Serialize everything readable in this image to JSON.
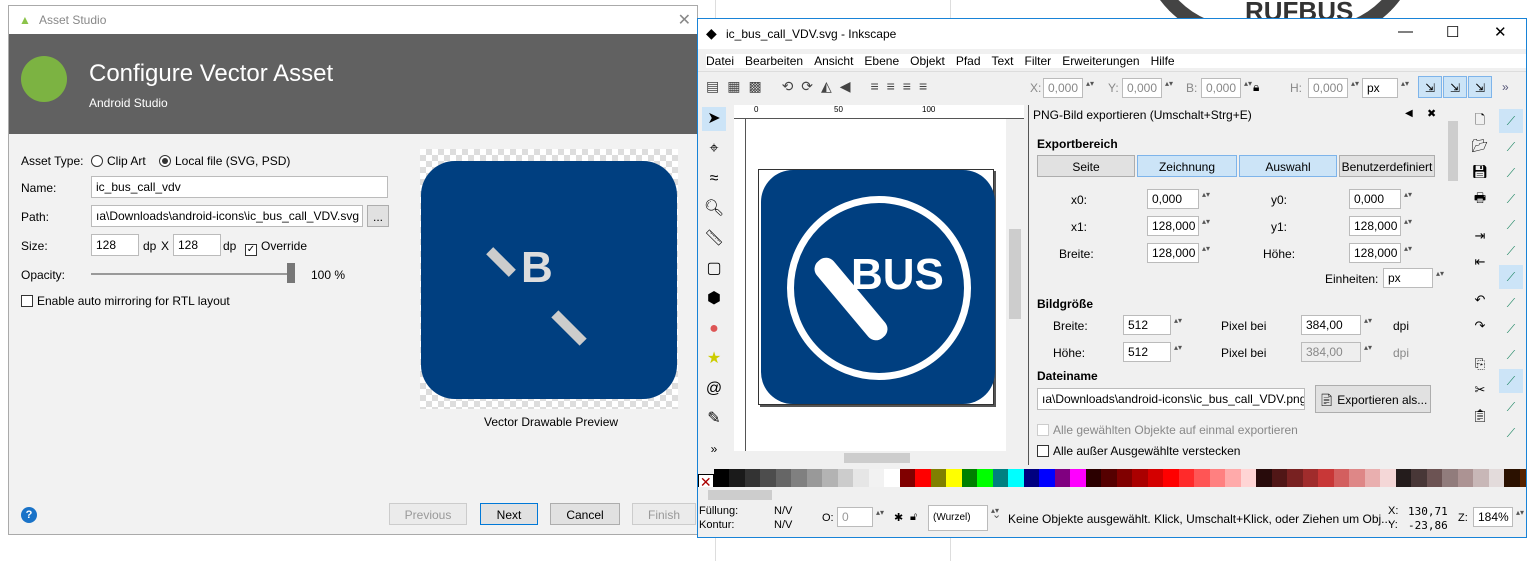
{
  "asset_studio": {
    "window_title": "Asset Studio",
    "header_title": "Configure Vector Asset",
    "header_subtitle": "Android Studio",
    "asset_type_label": "Asset Type:",
    "clip_art_label": "Clip Art",
    "local_file_label": "Local file (SVG, PSD)",
    "selected_asset_type": "Local file (SVG, PSD)",
    "name_label": "Name:",
    "name_value": "ic_bus_call_vdv",
    "path_label": "Path:",
    "path_value": "ıa\\Downloads\\android-icons\\ic_bus_call_VDV.svg",
    "browse_label": "...",
    "size_label": "Size:",
    "width_value": "128",
    "height_value": "128",
    "dp": "dp",
    "x": "X",
    "override_label": "Override",
    "override_checked": true,
    "opacity_label": "Opacity:",
    "opacity_value": "100 %",
    "opacity_percent": 100,
    "rtl_label": "Enable auto mirroring for RTL layout",
    "rtl_checked": false,
    "preview_label": "Vector Drawable Preview",
    "preview_letter": "B",
    "buttons": {
      "previous": "Previous",
      "next": "Next",
      "cancel": "Cancel",
      "finish": "Finish"
    },
    "help": "?"
  },
  "inkscape": {
    "window_title": "ic_bus_call_VDV.svg - Inkscape",
    "menu": [
      "Datei",
      "Bearbeiten",
      "Ansicht",
      "Ebene",
      "Objekt",
      "Pfad",
      "Text",
      "Filter",
      "Erweiterungen",
      "Hilfe"
    ],
    "toolbar": {
      "x_label": "X:",
      "x": "0,000",
      "y_label": "Y:",
      "y": "0,000",
      "b_label": "B:",
      "b": "0,000",
      "h_label": "H:",
      "h": "0,000",
      "unit": "px",
      "more": "»"
    },
    "ruler_ticks": [
      "0",
      "50",
      "100"
    ],
    "canvas_icon_text": "BUS",
    "export": {
      "title": "PNG-Bild exportieren (Umschalt+Strg+E)",
      "area_heading": "Exportbereich",
      "area_buttons": [
        {
          "label": "Seite",
          "active": false
        },
        {
          "label": "Zeichnung",
          "active": true
        },
        {
          "label": "Auswahl",
          "active": true
        },
        {
          "label": "Benutzerdefiniert",
          "active": false
        }
      ],
      "x0_label": "x0:",
      "x0": "0,000",
      "y0_label": "y0:",
      "y0": "0,000",
      "x1_label": "x1:",
      "x1": "128,000",
      "y1_label": "y1:",
      "y1": "128,000",
      "breite_label": "Breite:",
      "breite": "128,000",
      "hoehe_label": "Höhe:",
      "hoehe": "128,000",
      "units_label": "Einheiten:",
      "units": "px",
      "size_heading": "Bildgröße",
      "img_width_label": "Breite:",
      "img_width": "512",
      "dpi_label": "Pixel bei",
      "dpi": "384,00",
      "dpi_unit": "dpi",
      "img_height_label": "Höhe:",
      "img_height": "512",
      "dpi2": "384,00",
      "filename_heading": "Dateiname",
      "filename": "ıa\\Downloads\\android-icons\\ic_bus_call_VDV.png",
      "export_button": "Exportieren als...",
      "batch_label": "Alle gewählten Objekte auf einmal exportieren",
      "hide_label": "Alle außer Ausgewählte verstecken"
    },
    "palette": [
      "#000000",
      "#1a1a1a",
      "#333333",
      "#4d4d4d",
      "#666666",
      "#808080",
      "#999999",
      "#b3b3b3",
      "#cccccc",
      "#e6e6e6",
      "#f2f2f2",
      "#ffffff",
      "#800000",
      "#ff0000",
      "#808000",
      "#ffff00",
      "#008000",
      "#00ff00",
      "#008080",
      "#00ffff",
      "#000080",
      "#0000ff",
      "#800080",
      "#ff00ff",
      "#2b0000",
      "#550000",
      "#800000",
      "#aa0000",
      "#d40000",
      "#ff0000",
      "#ff2a2a",
      "#ff5555",
      "#ff8080",
      "#ffaaaa",
      "#ffd5d5",
      "#280b0b",
      "#501616",
      "#782121",
      "#a02c2c",
      "#c83737",
      "#d35f5f",
      "#de8787",
      "#e9afaf",
      "#f4d7d7",
      "#241c1c",
      "#483737",
      "#6c5353",
      "#917c7c",
      "#ac9393",
      "#c8b7b7",
      "#e3dbdb",
      "#2b1100",
      "#552200",
      "#803300",
      "#aa4400"
    ],
    "status": {
      "fill_label": "Füllung:",
      "fill": "N/V",
      "stroke_label": "Kontur:",
      "stroke": "N/V",
      "opacity_label": "O:",
      "opacity": "0",
      "layer": "(Wurzel)",
      "message": "Keine Objekte ausgewählt. Klick, Umschalt+Klick, oder Ziehen um Obj...",
      "x_label": "X:",
      "x": "130,71",
      "y_label": "Y:",
      "y": "-23,86",
      "zoom_label": "Z:",
      "zoom": "184%"
    }
  },
  "background": {
    "logo_text": "RUFBUS"
  },
  "colors": {
    "icon_blue": "#003f80",
    "header_gray": "#616161",
    "toggle_active": "#cce4f7"
  }
}
